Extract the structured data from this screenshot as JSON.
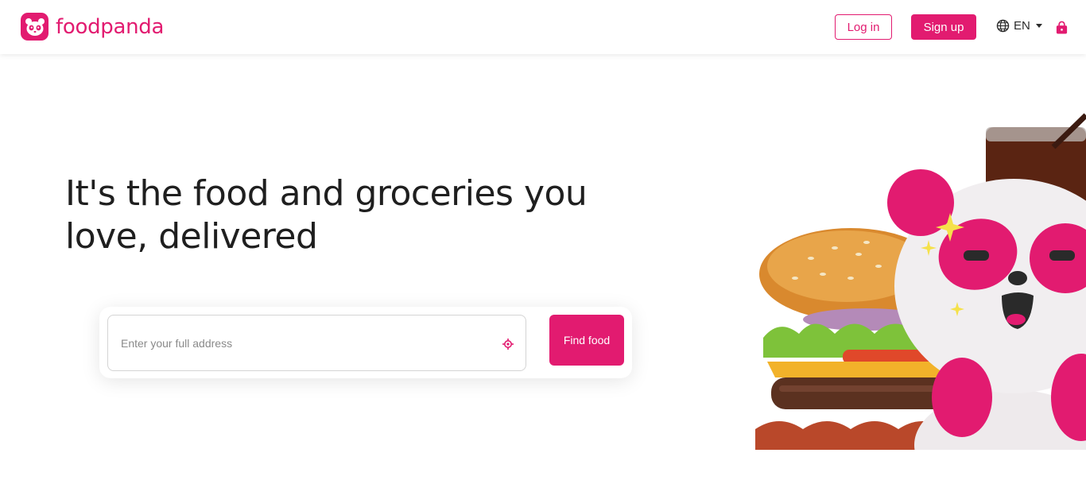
{
  "header": {
    "logo_text": "foodpanda",
    "logo_icon": "panda-face-icon",
    "login_label": "Log in",
    "signup_label": "Sign up",
    "language": "EN",
    "language_icon": "globe-icon",
    "cart_icon": "shopping-bag-icon"
  },
  "hero": {
    "title": "It's the food and groceries you love, delivered",
    "address_placeholder": "Enter your full address",
    "address_value": "",
    "locate_icon": "crosshair-locate-icon",
    "find_label": "Find food",
    "illustration": "burger-and-panda-mascot-image"
  },
  "colors": {
    "brand": "#e21b70",
    "text": "#1f1f1f",
    "input_border": "#d4d4d4"
  }
}
